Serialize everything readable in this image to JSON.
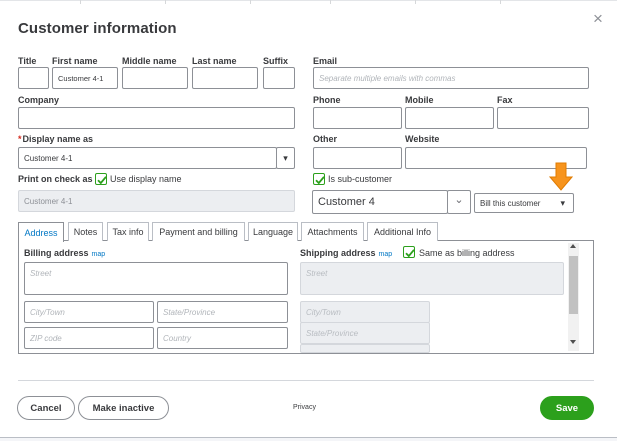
{
  "dialog": {
    "title": "Customer information",
    "close_glyph": "×"
  },
  "name": {
    "title_label": "Title",
    "first_label": "First name",
    "middle_label": "Middle name",
    "last_label": "Last name",
    "suffix_label": "Suffix",
    "first_value": "Customer 4-1",
    "title_value": "",
    "middle_value": "",
    "last_value": "",
    "suffix_value": ""
  },
  "email": {
    "label": "Email",
    "placeholder": "Separate multiple emails with commas"
  },
  "company": {
    "label": "Company",
    "value": ""
  },
  "phones": {
    "phone_label": "Phone",
    "mobile_label": "Mobile",
    "fax_label": "Fax",
    "other_label": "Other",
    "website_label": "Website"
  },
  "display_name": {
    "required_marker": "*",
    "label": "Display name as",
    "value": "Customer 4-1",
    "dropdown_glyph": "▾"
  },
  "print_on_check": {
    "label": "Print on check as",
    "use_display_name_label": "Use display name",
    "use_display_name_checked": true,
    "value": "Customer 4-1"
  },
  "sub_customer": {
    "label": "Is sub-customer",
    "checked": true,
    "parent_value": "Customer 4",
    "parent_chevron": "⌄",
    "bill_value": "Bill this customer",
    "bill_glyph": "▾"
  },
  "tabs": [
    {
      "label": "Address",
      "active": true
    },
    {
      "label": "Notes",
      "active": false
    },
    {
      "label": "Tax info",
      "active": false
    },
    {
      "label": "Payment and billing",
      "active": false
    },
    {
      "label": "Language",
      "active": false
    },
    {
      "label": "Attachments",
      "active": false
    },
    {
      "label": "Additional Info",
      "active": false
    }
  ],
  "billing": {
    "label": "Billing address",
    "map_link": "map",
    "street_placeholder": "Street",
    "city_placeholder": "City/Town",
    "state_placeholder": "State/Province",
    "zip_placeholder": "ZIP code",
    "country_placeholder": "Country"
  },
  "shipping": {
    "label": "Shipping address",
    "map_link": "map",
    "same_as_billing_label": "Same as billing address",
    "same_as_billing_checked": true,
    "street_placeholder": "Street",
    "city_placeholder": "City/Town",
    "state_placeholder": "State/Province"
  },
  "footer": {
    "cancel_label": "Cancel",
    "make_inactive_label": "Make inactive",
    "privacy_label": "Privacy",
    "save_label": "Save"
  },
  "colors": {
    "accent_green": "#2ca01c",
    "link_blue": "#0077c5",
    "annotation_arrow": "#f7941d",
    "required_red": "#d52b1e"
  },
  "icons": {
    "close": "close-icon",
    "dropdown": "chevron-down-icon",
    "check": "checkmark-icon",
    "annotation": "arrow-down-icon"
  }
}
